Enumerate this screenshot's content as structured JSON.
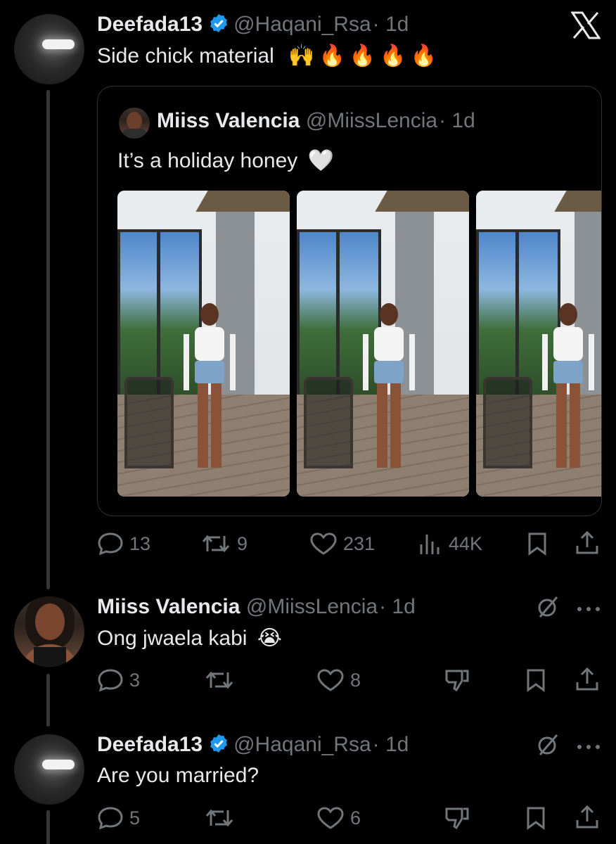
{
  "app": {
    "logo": "x-logo-icon"
  },
  "main_tweet": {
    "author_name": "Deefada13",
    "handle": "@Haqani_Rsa",
    "time": "· 1d",
    "verified": true,
    "text": "Side chick material",
    "emojis": "🙌🔥🔥🔥🔥",
    "quoted": {
      "author_name": "Miiss Valencia",
      "handle": "@MiissLencia",
      "time": "· 1d",
      "text": "It’s a holiday honey",
      "emoji": "🤍",
      "photos": [
        "photo-1",
        "photo-2",
        "photo-3"
      ]
    },
    "actions": {
      "replies": "13",
      "reposts": "9",
      "likes": "231",
      "views": "44K"
    }
  },
  "replies": [
    {
      "author_name": "Miiss Valencia",
      "handle": "@MiissLencia",
      "time": "· 1d",
      "text": "Ong jwaela kabi",
      "emoji": "😭",
      "actions": {
        "replies": "3",
        "reposts": "",
        "likes": "8"
      }
    },
    {
      "author_name": "Deefada13",
      "handle": "@Haqani_Rsa",
      "time": "· 1d",
      "verified": true,
      "text": "Are you married?",
      "actions": {
        "replies": "5",
        "reposts": "",
        "likes": "6"
      }
    }
  ],
  "colors": {
    "background": "#000000",
    "text": "#e7e9ea",
    "secondary": "#71767b",
    "verified": "#1d9bf0",
    "border": "#2f3336"
  }
}
